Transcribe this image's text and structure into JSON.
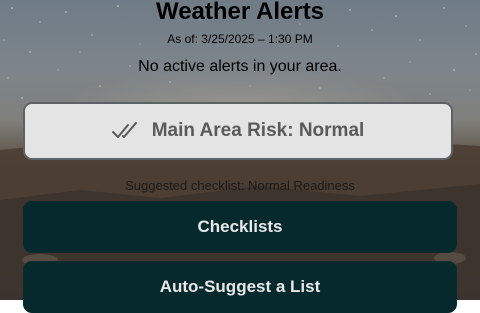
{
  "header": {
    "title": "Weather Alerts",
    "as_of": "As of: 3/25/2025 – 1:30 PM",
    "status_message": "No active alerts in your area."
  },
  "risk": {
    "label": "Main Area Risk: Normal",
    "icon": "double-checkmark-icon"
  },
  "suggested_checklist": "Suggested checklist: Normal Readiness",
  "buttons": {
    "checklists": "Checklists",
    "auto_suggest": "Auto-Suggest a List"
  },
  "colors": {
    "button_bg": "#06292e",
    "card_bg": "#e4e4e4",
    "card_border": "#5f6264"
  }
}
